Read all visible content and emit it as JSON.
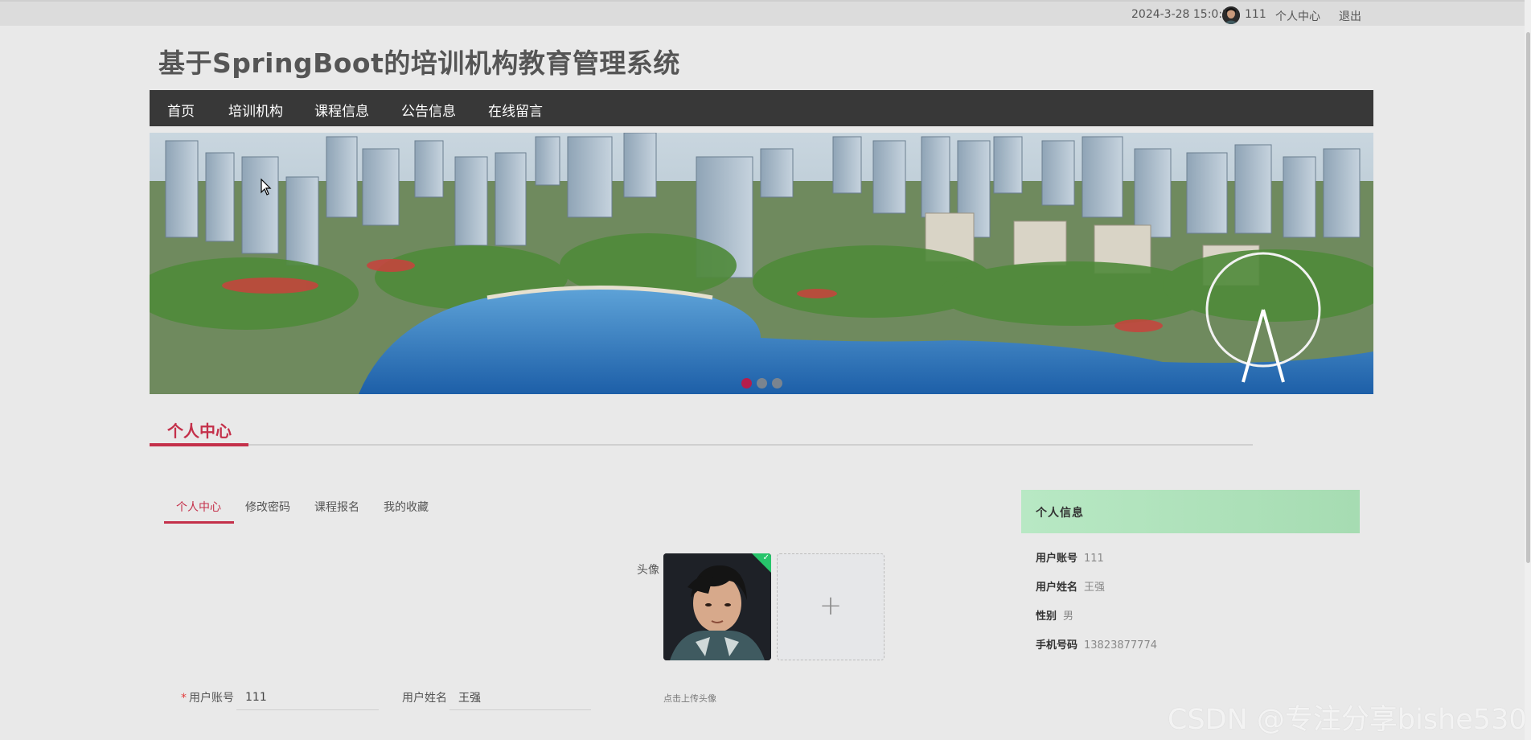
{
  "topbar": {
    "datetime": "2024-3-28 15:0:20",
    "username": "111",
    "center_link": "个人中心",
    "logout_link": "退出"
  },
  "site": {
    "title": "基于SpringBoot的培训机构教育管理系统"
  },
  "nav": [
    "首页",
    "培训机构",
    "课程信息",
    "公告信息",
    "在线留言"
  ],
  "carousel": {
    "slides": 3,
    "active_index": 0
  },
  "section": {
    "title": "个人中心"
  },
  "tabs": [
    "个人中心",
    "修改密码",
    "课程报名",
    "我的收藏"
  ],
  "avatar": {
    "label": "头像",
    "upload_plus": "+",
    "upload_hint": "点击上传头像"
  },
  "form": {
    "account_label": "用户账号",
    "account_value": "111",
    "name_label": "用户姓名",
    "name_value": "王强"
  },
  "info": {
    "header": "个人信息",
    "rows": [
      {
        "key": "用户账号",
        "value": "111"
      },
      {
        "key": "用户姓名",
        "value": "王强"
      },
      {
        "key": "性别",
        "value": "男"
      },
      {
        "key": "手机号码",
        "value": "13823877774"
      }
    ]
  },
  "watermark": "CSDN @专注分享bishe530",
  "colors": {
    "accent": "#c4304a",
    "nav_bg": "#383838",
    "info_header": "#b8e8c4"
  }
}
